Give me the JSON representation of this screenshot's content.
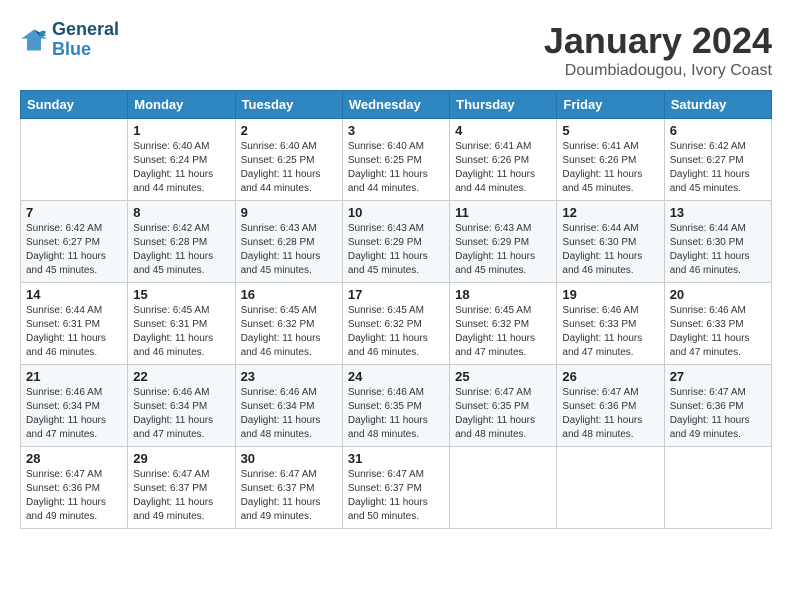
{
  "logo": {
    "line1": "General",
    "line2": "Blue"
  },
  "title": "January 2024",
  "location": "Doumbiadougou, Ivory Coast",
  "days_header": [
    "Sunday",
    "Monday",
    "Tuesday",
    "Wednesday",
    "Thursday",
    "Friday",
    "Saturday"
  ],
  "weeks": [
    [
      {
        "day": "",
        "sunrise": "",
        "sunset": "",
        "daylight": ""
      },
      {
        "day": "1",
        "sunrise": "Sunrise: 6:40 AM",
        "sunset": "Sunset: 6:24 PM",
        "daylight": "Daylight: 11 hours and 44 minutes."
      },
      {
        "day": "2",
        "sunrise": "Sunrise: 6:40 AM",
        "sunset": "Sunset: 6:25 PM",
        "daylight": "Daylight: 11 hours and 44 minutes."
      },
      {
        "day": "3",
        "sunrise": "Sunrise: 6:40 AM",
        "sunset": "Sunset: 6:25 PM",
        "daylight": "Daylight: 11 hours and 44 minutes."
      },
      {
        "day": "4",
        "sunrise": "Sunrise: 6:41 AM",
        "sunset": "Sunset: 6:26 PM",
        "daylight": "Daylight: 11 hours and 44 minutes."
      },
      {
        "day": "5",
        "sunrise": "Sunrise: 6:41 AM",
        "sunset": "Sunset: 6:26 PM",
        "daylight": "Daylight: 11 hours and 45 minutes."
      },
      {
        "day": "6",
        "sunrise": "Sunrise: 6:42 AM",
        "sunset": "Sunset: 6:27 PM",
        "daylight": "Daylight: 11 hours and 45 minutes."
      }
    ],
    [
      {
        "day": "7",
        "sunrise": "Sunrise: 6:42 AM",
        "sunset": "Sunset: 6:27 PM",
        "daylight": "Daylight: 11 hours and 45 minutes."
      },
      {
        "day": "8",
        "sunrise": "Sunrise: 6:42 AM",
        "sunset": "Sunset: 6:28 PM",
        "daylight": "Daylight: 11 hours and 45 minutes."
      },
      {
        "day": "9",
        "sunrise": "Sunrise: 6:43 AM",
        "sunset": "Sunset: 6:28 PM",
        "daylight": "Daylight: 11 hours and 45 minutes."
      },
      {
        "day": "10",
        "sunrise": "Sunrise: 6:43 AM",
        "sunset": "Sunset: 6:29 PM",
        "daylight": "Daylight: 11 hours and 45 minutes."
      },
      {
        "day": "11",
        "sunrise": "Sunrise: 6:43 AM",
        "sunset": "Sunset: 6:29 PM",
        "daylight": "Daylight: 11 hours and 45 minutes."
      },
      {
        "day": "12",
        "sunrise": "Sunrise: 6:44 AM",
        "sunset": "Sunset: 6:30 PM",
        "daylight": "Daylight: 11 hours and 46 minutes."
      },
      {
        "day": "13",
        "sunrise": "Sunrise: 6:44 AM",
        "sunset": "Sunset: 6:30 PM",
        "daylight": "Daylight: 11 hours and 46 minutes."
      }
    ],
    [
      {
        "day": "14",
        "sunrise": "Sunrise: 6:44 AM",
        "sunset": "Sunset: 6:31 PM",
        "daylight": "Daylight: 11 hours and 46 minutes."
      },
      {
        "day": "15",
        "sunrise": "Sunrise: 6:45 AM",
        "sunset": "Sunset: 6:31 PM",
        "daylight": "Daylight: 11 hours and 46 minutes."
      },
      {
        "day": "16",
        "sunrise": "Sunrise: 6:45 AM",
        "sunset": "Sunset: 6:32 PM",
        "daylight": "Daylight: 11 hours and 46 minutes."
      },
      {
        "day": "17",
        "sunrise": "Sunrise: 6:45 AM",
        "sunset": "Sunset: 6:32 PM",
        "daylight": "Daylight: 11 hours and 46 minutes."
      },
      {
        "day": "18",
        "sunrise": "Sunrise: 6:45 AM",
        "sunset": "Sunset: 6:32 PM",
        "daylight": "Daylight: 11 hours and 47 minutes."
      },
      {
        "day": "19",
        "sunrise": "Sunrise: 6:46 AM",
        "sunset": "Sunset: 6:33 PM",
        "daylight": "Daylight: 11 hours and 47 minutes."
      },
      {
        "day": "20",
        "sunrise": "Sunrise: 6:46 AM",
        "sunset": "Sunset: 6:33 PM",
        "daylight": "Daylight: 11 hours and 47 minutes."
      }
    ],
    [
      {
        "day": "21",
        "sunrise": "Sunrise: 6:46 AM",
        "sunset": "Sunset: 6:34 PM",
        "daylight": "Daylight: 11 hours and 47 minutes."
      },
      {
        "day": "22",
        "sunrise": "Sunrise: 6:46 AM",
        "sunset": "Sunset: 6:34 PM",
        "daylight": "Daylight: 11 hours and 47 minutes."
      },
      {
        "day": "23",
        "sunrise": "Sunrise: 6:46 AM",
        "sunset": "Sunset: 6:34 PM",
        "daylight": "Daylight: 11 hours and 48 minutes."
      },
      {
        "day": "24",
        "sunrise": "Sunrise: 6:46 AM",
        "sunset": "Sunset: 6:35 PM",
        "daylight": "Daylight: 11 hours and 48 minutes."
      },
      {
        "day": "25",
        "sunrise": "Sunrise: 6:47 AM",
        "sunset": "Sunset: 6:35 PM",
        "daylight": "Daylight: 11 hours and 48 minutes."
      },
      {
        "day": "26",
        "sunrise": "Sunrise: 6:47 AM",
        "sunset": "Sunset: 6:36 PM",
        "daylight": "Daylight: 11 hours and 48 minutes."
      },
      {
        "day": "27",
        "sunrise": "Sunrise: 6:47 AM",
        "sunset": "Sunset: 6:36 PM",
        "daylight": "Daylight: 11 hours and 49 minutes."
      }
    ],
    [
      {
        "day": "28",
        "sunrise": "Sunrise: 6:47 AM",
        "sunset": "Sunset: 6:36 PM",
        "daylight": "Daylight: 11 hours and 49 minutes."
      },
      {
        "day": "29",
        "sunrise": "Sunrise: 6:47 AM",
        "sunset": "Sunset: 6:37 PM",
        "daylight": "Daylight: 11 hours and 49 minutes."
      },
      {
        "day": "30",
        "sunrise": "Sunrise: 6:47 AM",
        "sunset": "Sunset: 6:37 PM",
        "daylight": "Daylight: 11 hours and 49 minutes."
      },
      {
        "day": "31",
        "sunrise": "Sunrise: 6:47 AM",
        "sunset": "Sunset: 6:37 PM",
        "daylight": "Daylight: 11 hours and 50 minutes."
      },
      {
        "day": "",
        "sunrise": "",
        "sunset": "",
        "daylight": ""
      },
      {
        "day": "",
        "sunrise": "",
        "sunset": "",
        "daylight": ""
      },
      {
        "day": "",
        "sunrise": "",
        "sunset": "",
        "daylight": ""
      }
    ]
  ]
}
